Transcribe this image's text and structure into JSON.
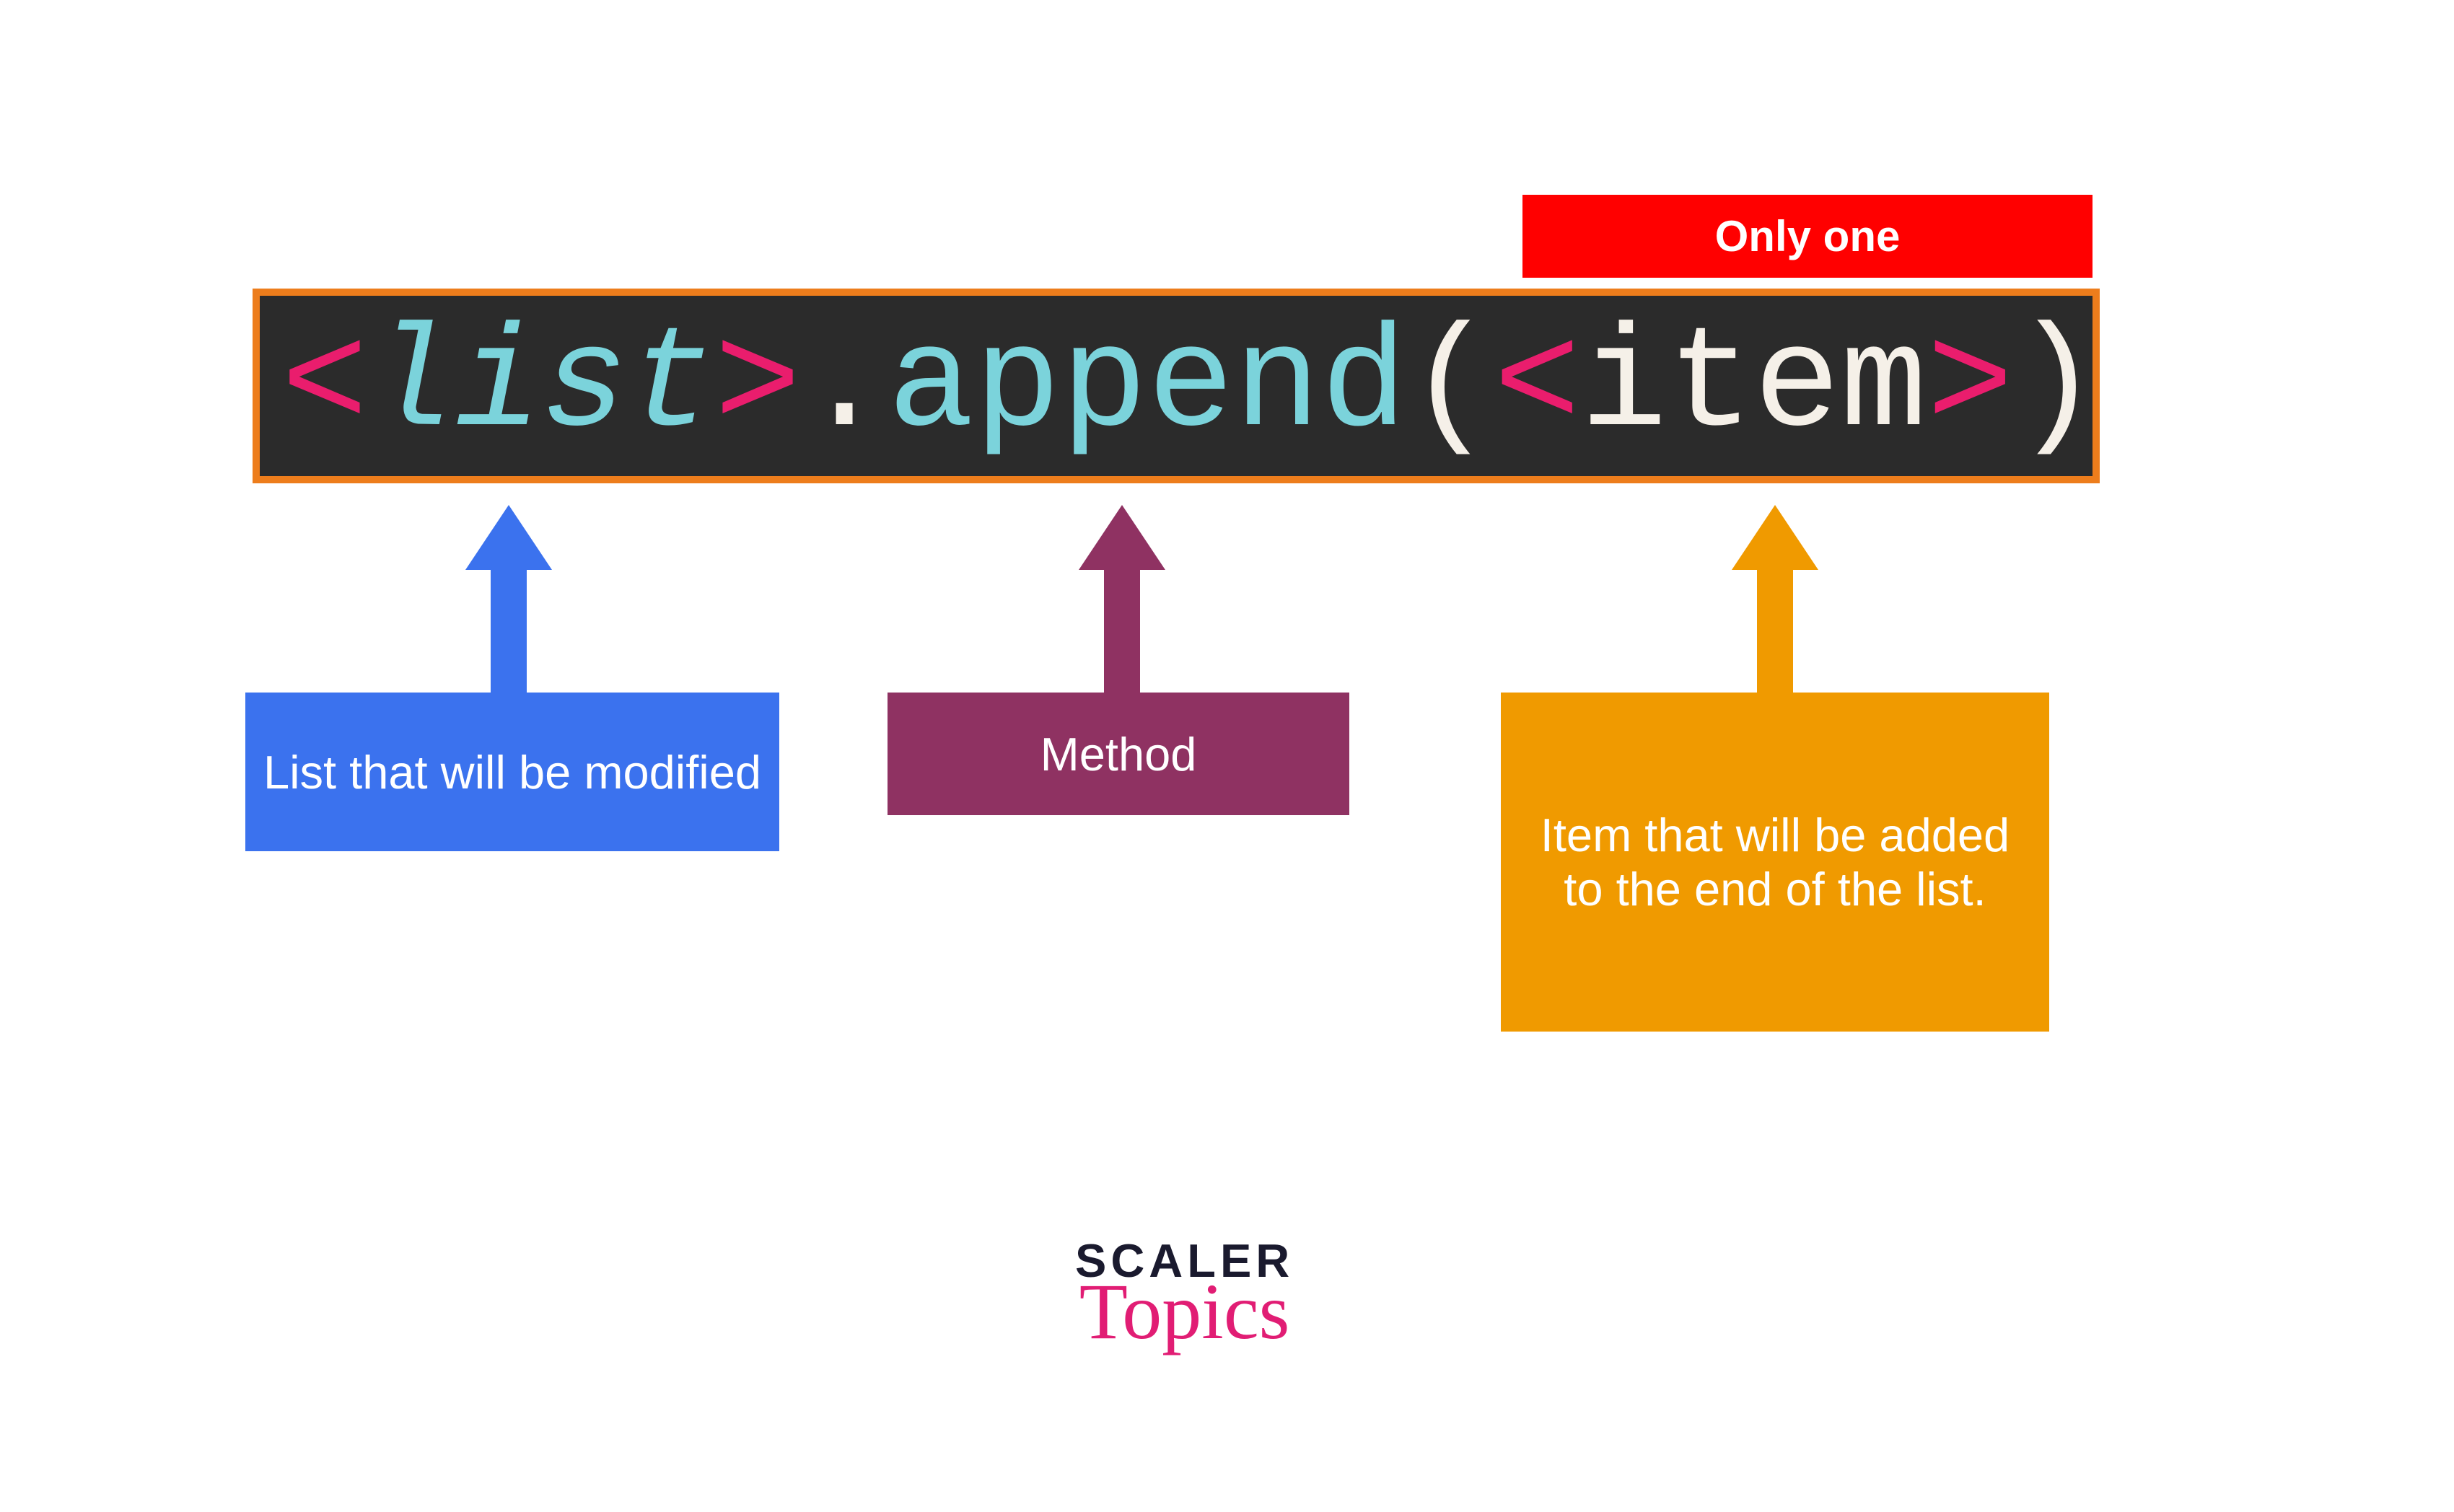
{
  "badge": {
    "label": "Only one"
  },
  "code": {
    "lt1": "<",
    "list": "list",
    "gt1": ">",
    "dot": ".",
    "append": "append",
    "lparen": "(",
    "lt2": "<",
    "item": "item",
    "gt2": ">",
    "rparen": ")"
  },
  "labels": {
    "list": "List that will be modified",
    "method": "Method",
    "item": "Item that will be added to the end of the list."
  },
  "logo": {
    "line1": "SCALER",
    "line2": "Topics"
  },
  "colors": {
    "badge_bg": "#ff0000",
    "code_bg": "#2b2b2b",
    "code_border": "#ed7d1c",
    "bracket": "#ea1d6d",
    "list_text": "#7bd3db",
    "white_text": "#f5f0e8",
    "label_blue": "#3b72ee",
    "label_purple": "#8f3262",
    "label_orange": "#f09a00",
    "logo_dark": "#1a1a2e",
    "logo_pink": "#e11d74"
  }
}
